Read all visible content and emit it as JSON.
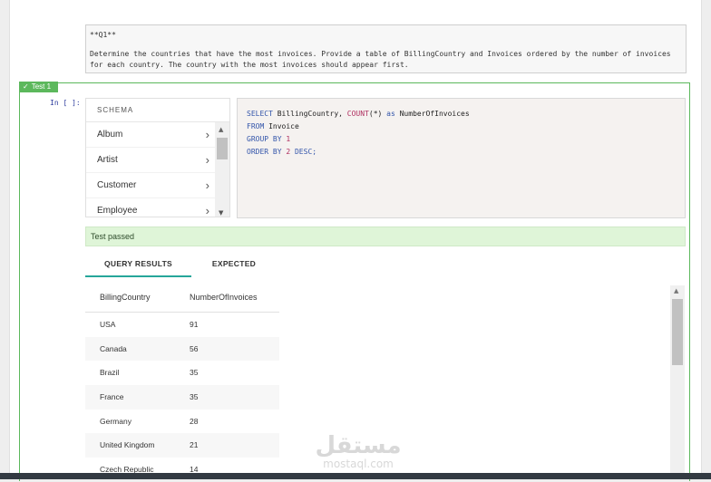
{
  "question": {
    "title": "**Q1**",
    "body": "Determine the countries that have the most invoices. Provide a table of BillingCountry and Invoices ordered by the number of invoices for each country. The country with the most invoices should appear first."
  },
  "test": {
    "label": "Test 1",
    "prompt": "In [ ]:"
  },
  "schema": {
    "header": "SCHEMA",
    "items": [
      "Album",
      "Artist",
      "Customer",
      "Employee"
    ]
  },
  "sql": {
    "line1": {
      "kw1": "SELECT",
      "t1": " BillingCountry, ",
      "fn": "COUNT",
      "t2": "(*) ",
      "kw2": "as",
      "t3": " NumberOfInvoices"
    },
    "line2": {
      "kw": "FROM",
      "t": " Invoice"
    },
    "line3": {
      "kw": "GROUP BY",
      "n": " 1"
    },
    "line4": {
      "kw1": "ORDER BY",
      "n": " 2",
      "kw2": " DESC;"
    }
  },
  "status": {
    "text": "Test passed"
  },
  "tabs": {
    "results": "QUERY RESULTS",
    "expected": "EXPECTED"
  },
  "table": {
    "headers": [
      "BillingCountry",
      "NumberOfInvoices"
    ],
    "rows": [
      [
        "USA",
        "91"
      ],
      [
        "Canada",
        "56"
      ],
      [
        "Brazil",
        "35"
      ],
      [
        "France",
        "35"
      ],
      [
        "Germany",
        "28"
      ],
      [
        "United Kingdom",
        "21"
      ],
      [
        "Czech Republic",
        "14"
      ]
    ]
  },
  "watermark": {
    "arabic": "مستقل",
    "latin": "mostaql.com"
  },
  "colors": {
    "test_green": "#5cb85c",
    "passed_bg": "#dff5d8",
    "tab_accent": "#26a69a",
    "editor_bg": "#f5f2f0"
  }
}
